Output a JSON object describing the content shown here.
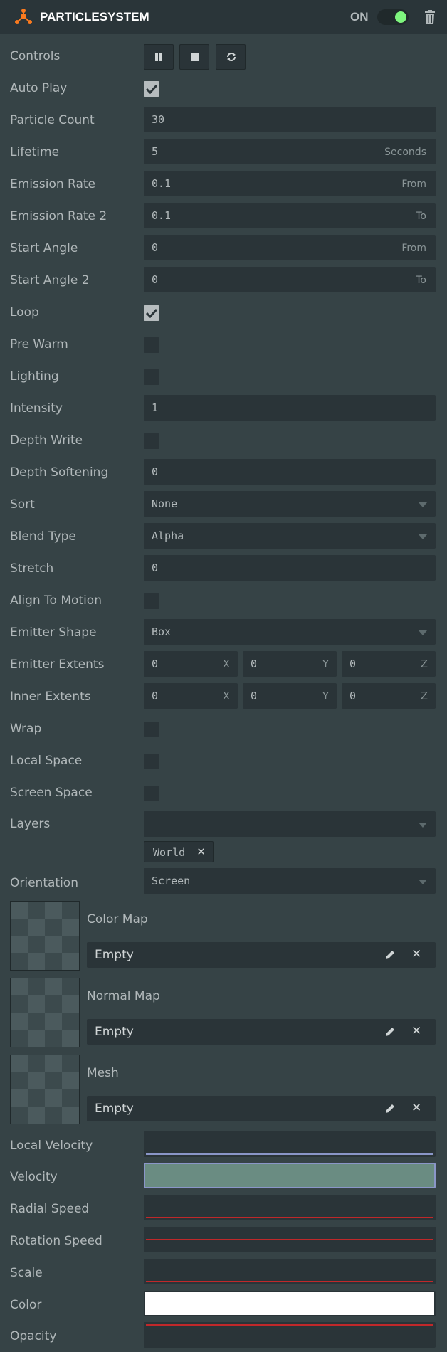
{
  "header": {
    "title": "PARTICLESYSTEM",
    "toggle_label": "ON",
    "toggle_state": "on",
    "accent_color": "#f97a1f",
    "toggle_color": "#7ef57e"
  },
  "rows": {
    "controls": "Controls",
    "auto_play": {
      "label": "Auto Play",
      "checked": true
    },
    "particle_count": {
      "label": "Particle Count",
      "value": "30"
    },
    "lifetime": {
      "label": "Lifetime",
      "value": "5",
      "suffix": "Seconds"
    },
    "emission_rate": {
      "label": "Emission Rate",
      "value": "0.1",
      "suffix": "From"
    },
    "emission_rate2": {
      "label": "Emission Rate 2",
      "value": "0.1",
      "suffix": "To"
    },
    "start_angle": {
      "label": "Start Angle",
      "value": "0",
      "suffix": "From"
    },
    "start_angle2": {
      "label": "Start Angle 2",
      "value": "0",
      "suffix": "To"
    },
    "loop": {
      "label": "Loop",
      "checked": true
    },
    "pre_warm": {
      "label": "Pre Warm",
      "checked": false
    },
    "lighting": {
      "label": "Lighting",
      "checked": false
    },
    "intensity": {
      "label": "Intensity",
      "value": "1"
    },
    "depth_write": {
      "label": "Depth Write",
      "checked": false
    },
    "depth_softening": {
      "label": "Depth Softening",
      "value": "0"
    },
    "sort": {
      "label": "Sort",
      "value": "None"
    },
    "blend_type": {
      "label": "Blend Type",
      "value": "Alpha"
    },
    "stretch": {
      "label": "Stretch",
      "value": "0"
    },
    "align_to_motion": {
      "label": "Align To Motion",
      "checked": false
    },
    "emitter_shape": {
      "label": "Emitter Shape",
      "value": "Box"
    },
    "emitter_extents": {
      "label": "Emitter Extents",
      "x": "0",
      "y": "0",
      "z": "0",
      "ax": "X",
      "ay": "Y",
      "az": "Z"
    },
    "inner_extents": {
      "label": "Inner Extents",
      "x": "0",
      "y": "0",
      "z": "0",
      "ax": "X",
      "ay": "Y",
      "az": "Z"
    },
    "wrap": {
      "label": "Wrap",
      "checked": false
    },
    "local_space": {
      "label": "Local Space",
      "checked": false
    },
    "screen_space": {
      "label": "Screen Space",
      "checked": false
    },
    "layers": {
      "label": "Layers",
      "value": "",
      "tag": "World",
      "tag_remove": "✕"
    },
    "orientation": {
      "label": "Orientation",
      "value": "Screen"
    }
  },
  "assets": [
    {
      "name": "Color Map",
      "value": "Empty",
      "remove": "✕"
    },
    {
      "name": "Normal Map",
      "value": "Empty",
      "remove": "✕"
    },
    {
      "name": "Mesh",
      "value": "Empty",
      "remove": "✕"
    }
  ],
  "curves": {
    "local_velocity": "Local Velocity",
    "velocity": "Velocity",
    "radial_speed": "Radial Speed",
    "rotation_speed": "Rotation Speed",
    "scale": "Scale",
    "color": "Color",
    "opacity": "Opacity",
    "line_color_blue": "#8a96c8",
    "line_color_red": "#c0282a"
  }
}
